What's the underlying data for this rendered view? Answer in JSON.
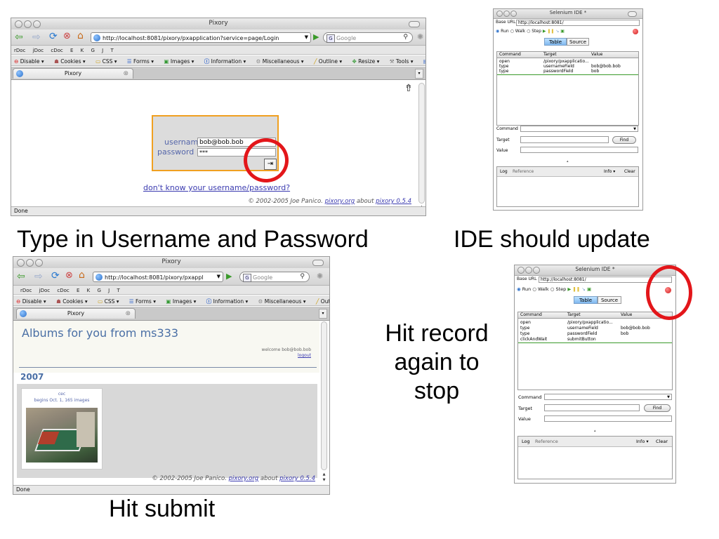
{
  "captions": {
    "top_left": "Type in Username and Password",
    "top_right": "IDE should update",
    "mid_right": [
      "Hit record",
      "again to",
      "stop"
    ],
    "bottom_left": "Hit submit"
  },
  "browser_login": {
    "title": "Pixory",
    "url": "http://localhost:8081/pixory/pxapplication?service=page/Login",
    "search_placeholder": "Google",
    "bookmarks": [
      "rDoc",
      "jDoc",
      "cDoc",
      "E",
      "K",
      "G",
      "J",
      "T"
    ],
    "webdev": [
      "Disable ▾",
      "Cookies ▾",
      "CSS ▾",
      "Forms ▾",
      "Images ▾",
      "Information ▾",
      "Miscellaneous ▾",
      "Outline ▾",
      "Resize ▾",
      "Tools ▾",
      "Vi"
    ],
    "tab_label": "Pixory",
    "username_label": "username",
    "username_value": "bob@bob.bob",
    "password_label": "password",
    "password_value": "***",
    "forgot_link": "don't know your username/password?",
    "footer_prefix": "© 2002-2005 Joe Panico.",
    "footer_link1": "pixory.org",
    "footer_mid": "about",
    "footer_link2": "pixory 0.5.4",
    "status": "Done"
  },
  "browser_albums": {
    "title": "Pixory",
    "url": "http://localhost:8081/pixory/pxappl",
    "search_placeholder": "Google",
    "bookmarks": [
      "rDoc",
      "jDoc",
      "cDoc",
      "E",
      "K",
      "G",
      "J",
      "T"
    ],
    "webdev": [
      "Disable ▾",
      "Cookies ▾",
      "CSS ▾",
      "Forms ▾",
      "Images ▾",
      "Information ▾",
      "Miscellaneous ▾",
      "Outlin"
    ],
    "tab_label": "Pixory",
    "heading": "Albums for you from ms333",
    "welcome": "welcome bob@bob.bob",
    "logout": "logout",
    "year": "2007",
    "album_name": "cec",
    "album_info": "begins Oct. 1, 165 images",
    "footer_prefix": "© 2002-2005 Joe Panico.",
    "footer_link1": "pixory.org",
    "footer_mid": "about",
    "footer_link2": "pixory 0.5.4",
    "status": "Done"
  },
  "ide_top": {
    "title": "Selenium IDE *",
    "base_url_label": "Base URL",
    "base_url": "http://localhost:8081/",
    "run": "Run",
    "walk": "Walk",
    "step": "Step",
    "tab_table": "Table",
    "tab_source": "Source",
    "col_command": "Command",
    "col_target": "Target",
    "col_value": "Value",
    "rows": [
      {
        "command": "open",
        "target": "/pixory/pxapplicatio...",
        "value": ""
      },
      {
        "command": "type",
        "target": "usernameField",
        "value": "bob@bob.bob"
      },
      {
        "command": "type",
        "target": "passwordField",
        "value": "bob"
      }
    ],
    "command_label": "Command",
    "target_label": "Target",
    "value_label": "Value",
    "find": "Find",
    "log_tab": "Log",
    "reference_tab": "Reference",
    "info": "Info ▾",
    "clear": "Clear"
  },
  "ide_bottom": {
    "title": "Selenium IDE *",
    "base_url_label": "Base URL",
    "base_url": "http://localhost:8081/",
    "run": "Run",
    "walk": "Walk",
    "step": "Step",
    "tab_table": "Table",
    "tab_source": "Source",
    "col_command": "Command",
    "col_target": "Target",
    "col_value": "Value",
    "rows": [
      {
        "command": "open",
        "target": "/pixory/pxapplicatio...",
        "value": ""
      },
      {
        "command": "type",
        "target": "usernameField",
        "value": "bob@bob.bob"
      },
      {
        "command": "type",
        "target": "passwordField",
        "value": "bob"
      },
      {
        "command": "clickAndWait",
        "target": "submitButton",
        "value": ""
      }
    ],
    "command_label": "Command",
    "target_label": "Target",
    "value_label": "Value",
    "find": "Find",
    "log_tab": "Log",
    "reference_tab": "Reference",
    "info": "Info ▾",
    "clear": "Clear"
  },
  "colors": {
    "annotation_ring": "#e3161a",
    "login_box_border": "#f0a020",
    "link_blue": "#3b3bb0",
    "heading_blue": "#4a6fa5",
    "record_red": "#e03030"
  }
}
